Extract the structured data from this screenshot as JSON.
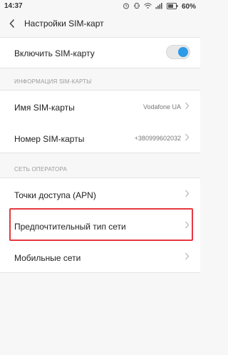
{
  "status_bar": {
    "time": "14:37",
    "battery_percent": "60%"
  },
  "header": {
    "title": "Настройки SIM-карт",
    "back_icon": "chevron-left-icon"
  },
  "toggle_row": {
    "label": "Включить SIM-карту",
    "enabled": true,
    "accent_color": "#2d9be8"
  },
  "sim_info": {
    "section_title": "ИНФОРМАЦИЯ SIM-КАРТЫ",
    "rows": [
      {
        "label": "Имя SIM-карты",
        "value": "Vodafone UA"
      },
      {
        "label": "Номер SIM-карты",
        "value": "+380999602032"
      }
    ]
  },
  "operator": {
    "section_title": "СЕТЬ ОПЕРАТОРА",
    "rows": [
      {
        "label": "Точки доступа (APN)"
      },
      {
        "label": "Предпочтительный тип сети",
        "highlighted": true
      },
      {
        "label": "Мобильные сети"
      }
    ]
  },
  "highlight_color": "#e53940"
}
